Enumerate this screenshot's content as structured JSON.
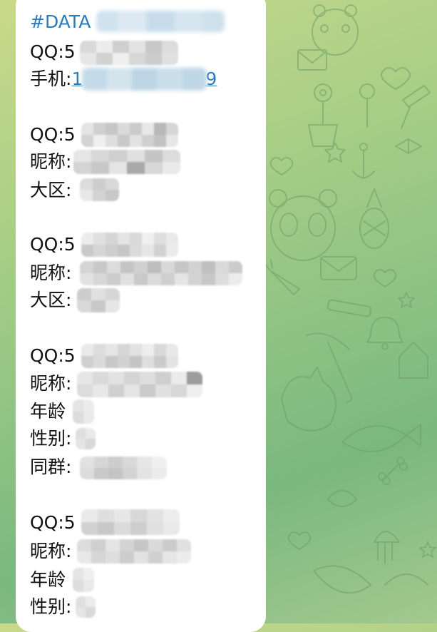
{
  "chat_background": {
    "gradient_colors": [
      "#c9d98a",
      "#8fc384",
      "#7ab87e"
    ],
    "doodle_color": "#6f9f6a",
    "doodle_icons": [
      "panda-icon",
      "envelope-icon",
      "flower-pot-icon",
      "lollipop-icon",
      "bow-icon",
      "anchor-icon",
      "pineapple-icon",
      "carrot-icon",
      "candle-icon",
      "bell-icon",
      "umbrella-icon",
      "cat-icon",
      "fish-icon",
      "jellyfish-icon",
      "heart-icon",
      "star-icon",
      "bone-icon",
      "shell-icon"
    ]
  },
  "message": {
    "bubble_color": "#ffffff",
    "text_color": "#111111",
    "link_color": "#2b7cbf",
    "header": {
      "hashtag_prefix": "#DATA",
      "hashtag_suffix": "5",
      "contact_prefix": "手机:",
      "contact_link_start": "1",
      "contact_link_end": "9"
    },
    "records": [
      {
        "lines": [
          {
            "label": "QQ:",
            "visible": "5"
          }
        ]
      },
      {
        "lines": [
          {
            "label": "QQ:",
            "visible": "5"
          },
          {
            "label": "昵称:",
            "visible": ""
          },
          {
            "label": "大区:",
            "visible": ""
          }
        ]
      },
      {
        "lines": [
          {
            "label": "QQ:",
            "visible": "5"
          },
          {
            "label": "昵称:",
            "visible": ""
          },
          {
            "label": "大区:",
            "visible": ""
          }
        ]
      },
      {
        "lines": [
          {
            "label": "QQ:",
            "visible": "5"
          },
          {
            "label": "昵称:",
            "visible": ""
          },
          {
            "label": "年龄",
            "visible": ""
          },
          {
            "label": "性别:",
            "visible": ""
          },
          {
            "label": "同群:",
            "visible": ""
          }
        ]
      },
      {
        "lines": [
          {
            "label": "QQ:",
            "visible": "5"
          },
          {
            "label": "昵称:",
            "visible": ""
          },
          {
            "label": "年龄",
            "visible": ""
          },
          {
            "label": "性别:",
            "visible": ""
          }
        ]
      }
    ],
    "redaction": "pixelated"
  }
}
